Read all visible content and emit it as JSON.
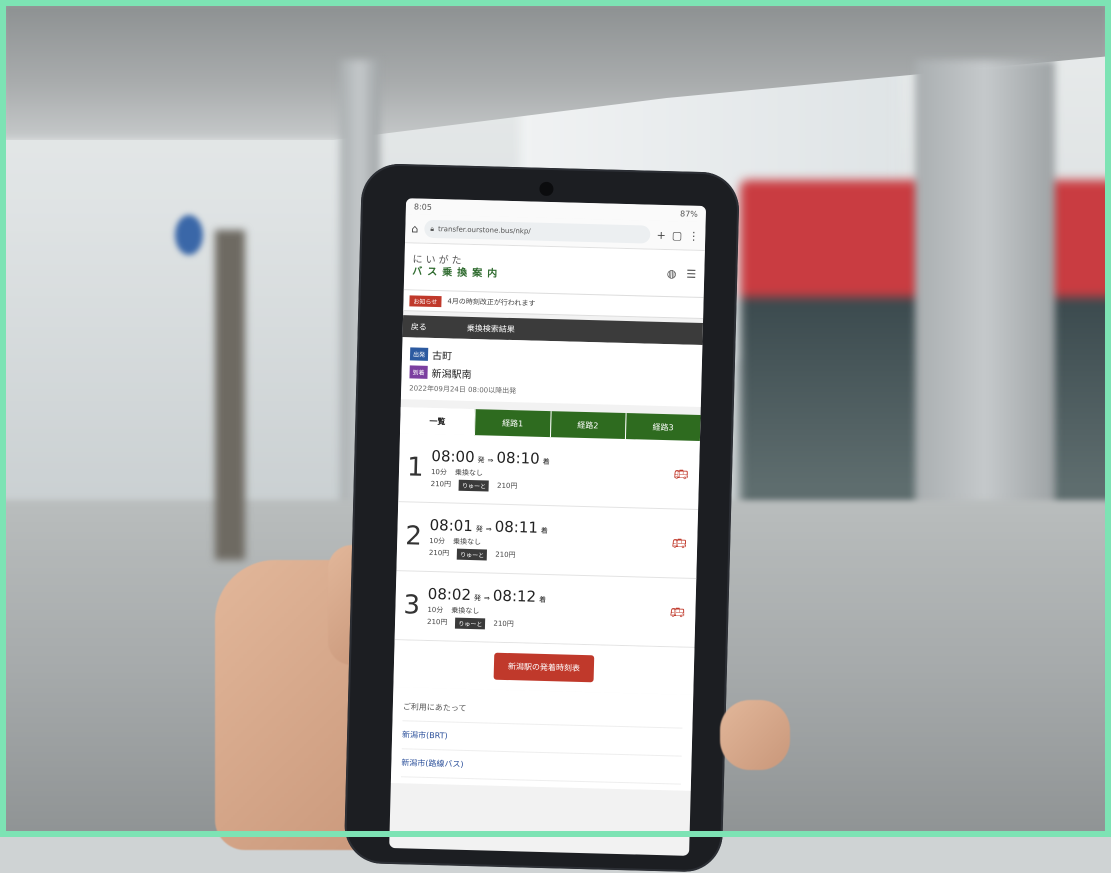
{
  "phone": {
    "status": {
      "left": "8:05",
      "right": "87%"
    },
    "browser": {
      "url": "transfer.ourstone.bus/nkp/"
    },
    "site": {
      "logo_line1": "にいがた",
      "logo_line2": "バス乗換案内",
      "notice_tag": "お知らせ",
      "notice_text": "4月の時刻改正が行われます",
      "back_label": "戻る",
      "page_title": "乗換検索結果"
    },
    "route": {
      "from_badge": "出発",
      "from": "古町",
      "to_badge": "到着",
      "to": "新潟駅南",
      "date": "2022年09月24日 08:00以降出発"
    },
    "tabs": [
      {
        "label": "一覧",
        "style": "active"
      },
      {
        "label": "経路1",
        "style": "green"
      },
      {
        "label": "経路2",
        "style": "green"
      },
      {
        "label": "経路3",
        "style": "green"
      }
    ],
    "results": [
      {
        "num": "1",
        "dep": "08:00",
        "dep_suffix": "発",
        "arr": "08:10",
        "arr_suffix": "着",
        "duration": "10分",
        "transfer": "乗換なし",
        "fare": "210円",
        "ic_tag": "りゅーと",
        "ic_fare": "210円"
      },
      {
        "num": "2",
        "dep": "08:01",
        "dep_suffix": "発",
        "arr": "08:11",
        "arr_suffix": "着",
        "duration": "10分",
        "transfer": "乗換なし",
        "fare": "210円",
        "ic_tag": "りゅーと",
        "ic_fare": "210円"
      },
      {
        "num": "3",
        "dep": "08:02",
        "dep_suffix": "発",
        "arr": "08:12",
        "arr_suffix": "着",
        "duration": "10分",
        "transfer": "乗換なし",
        "fare": "210円",
        "ic_tag": "りゅーと",
        "ic_fare": "210円"
      }
    ],
    "cta_label": "新潟駅の発着時刻表",
    "links": {
      "head": "ご利用にあたって",
      "items": [
        "新潟市(BRT)",
        "新潟市(路線バス)"
      ]
    }
  },
  "icons": [
    "home-icon",
    "lock-icon",
    "plus-icon",
    "tabs-icon",
    "menu-dots-icon",
    "bus-stop-icon",
    "hamburger-icon",
    "bus-icon"
  ]
}
